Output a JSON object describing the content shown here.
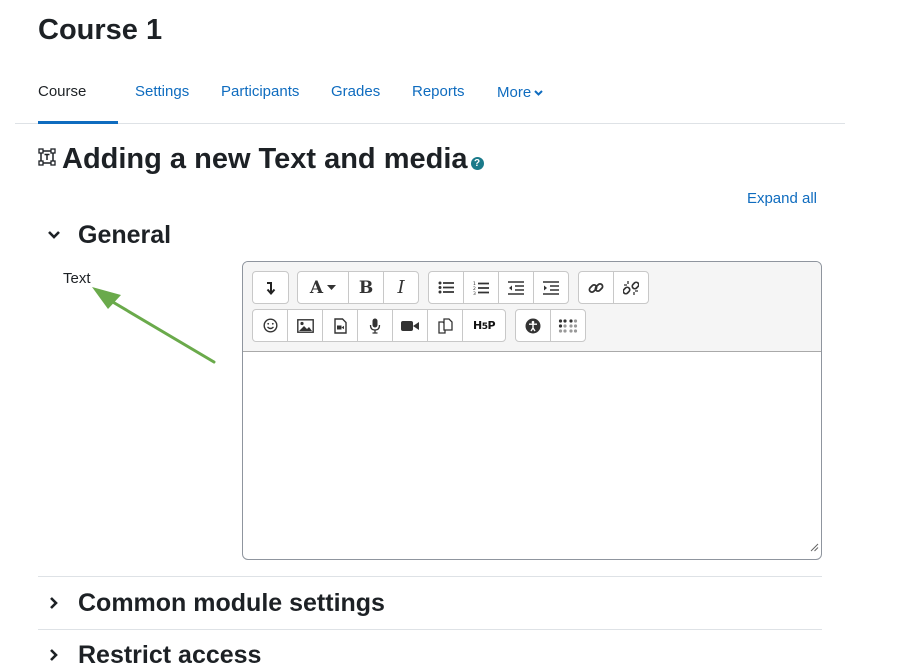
{
  "course": {
    "title": "Course 1"
  },
  "nav": {
    "tabs": [
      {
        "label": "Course",
        "active": true
      },
      {
        "label": "Settings"
      },
      {
        "label": "Participants"
      },
      {
        "label": "Grades"
      },
      {
        "label": "Reports"
      },
      {
        "label": "More"
      }
    ]
  },
  "page": {
    "heading": "Adding a new Text and media",
    "help_icon": "question-circle-icon",
    "heading_icon": "text-and-media-icon"
  },
  "form": {
    "expand_all": "Expand all",
    "sections": [
      {
        "title": "General",
        "expanded": true
      },
      {
        "title": "Common module settings",
        "expanded": false
      },
      {
        "title": "Restrict access",
        "expanded": false
      }
    ],
    "text_label": "Text"
  },
  "editor": {
    "content": "",
    "toolbar_row1": [
      [
        "collapse-toolbar-icon"
      ],
      [
        "paragraph-style-icon",
        "bold-icon",
        "italic-icon"
      ],
      [
        "unordered-list-icon",
        "ordered-list-icon",
        "outdent-icon",
        "indent-icon"
      ],
      [
        "link-icon",
        "unlink-icon"
      ]
    ],
    "toolbar_row2": [
      [
        "emoji-icon",
        "image-icon",
        "media-icon",
        "record-audio-icon",
        "record-video-icon",
        "manage-files-icon",
        "h5p-icon"
      ],
      [
        "accessibility-checker-icon",
        "screenreader-helper-icon"
      ]
    ]
  },
  "annotation": {
    "arrow_color": "#6aaa4b"
  },
  "colors": {
    "link": "#0f6cbf",
    "text": "#1d2125"
  }
}
